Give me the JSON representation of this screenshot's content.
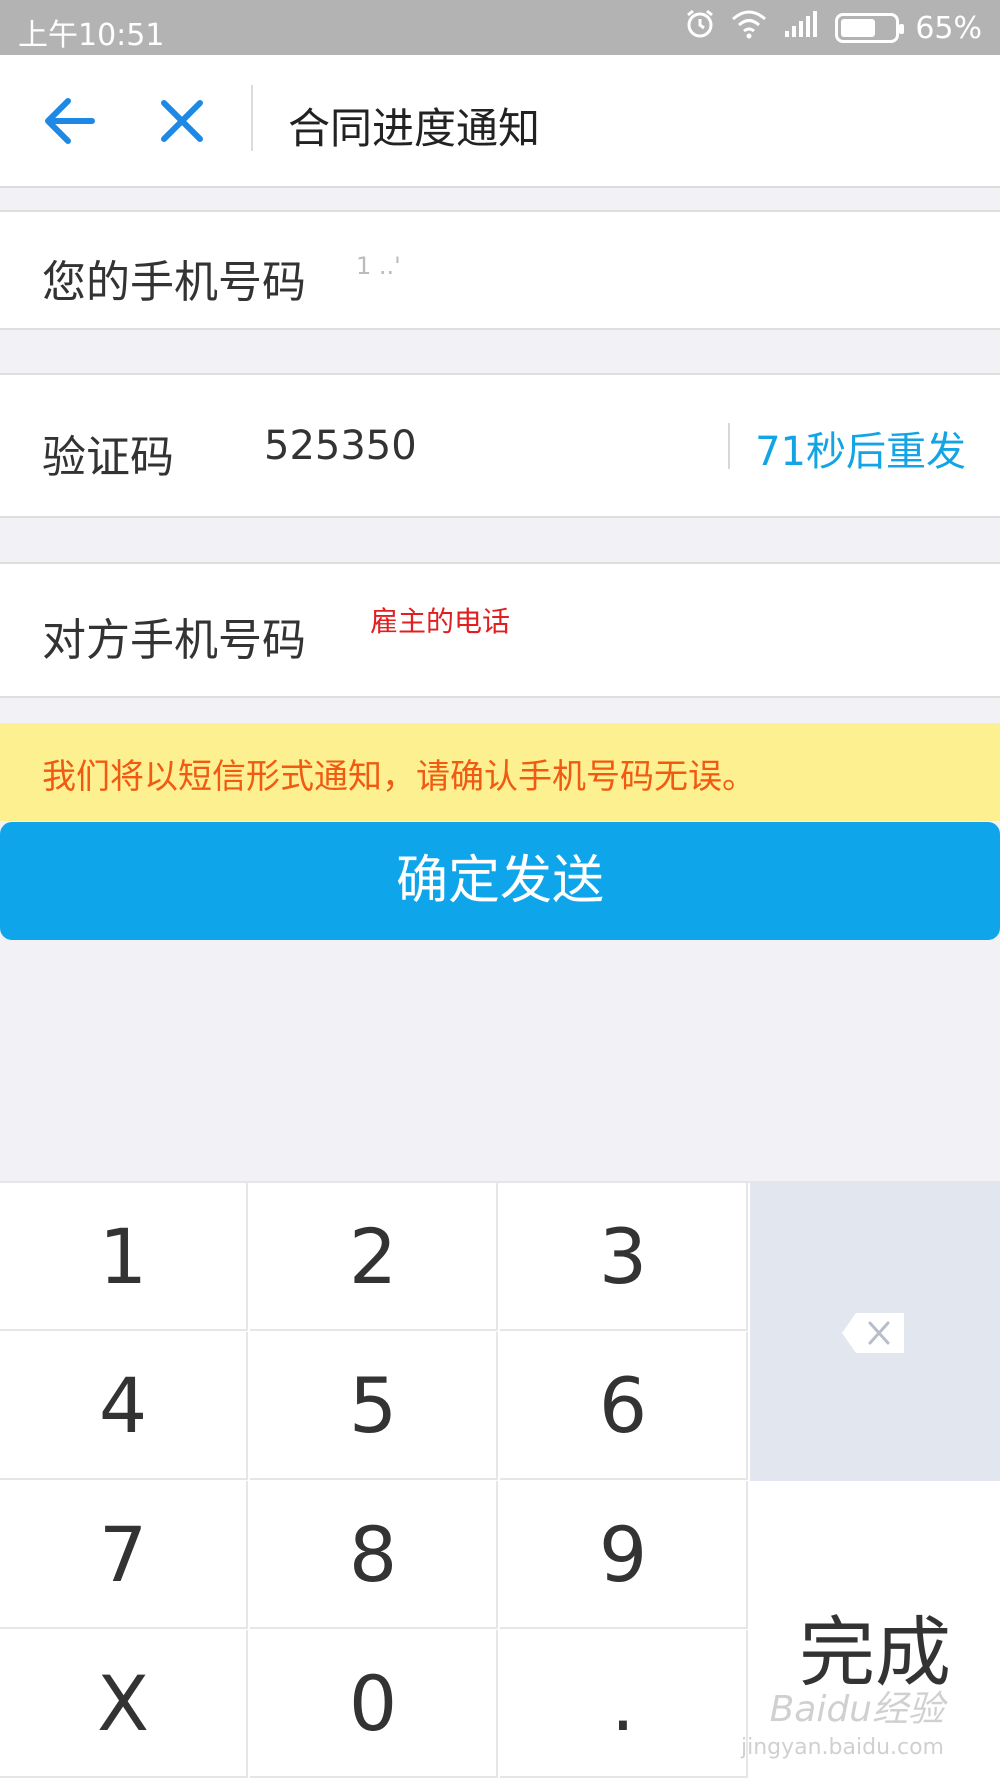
{
  "status_bar": {
    "time": "上午10:51",
    "battery_percent": "65%",
    "battery_level": 0.65,
    "icons": [
      "alarm-icon",
      "wifi-icon",
      "signal-icon",
      "battery-icon"
    ]
  },
  "nav": {
    "title": "合同进度通知",
    "back_icon": "arrow-left-icon",
    "close_icon": "close-icon",
    "accent_color": "#1e88e5"
  },
  "form": {
    "my_phone_label": "您的手机号码",
    "my_phone_value": "1          ..'",
    "code_label": "验证码",
    "code_value": "525350",
    "resend_label": "71秒后重发",
    "other_phone_label": "对方手机号码",
    "other_phone_hint": "雇主的电话"
  },
  "notice": {
    "text": "我们将以短信形式通知，请确认手机号码无误。",
    "bg_color": "#fdf090",
    "text_color": "#f05a12"
  },
  "send_button": {
    "label": "确定发送",
    "color": "#0fa5ea"
  },
  "keypad": {
    "keys": [
      "1",
      "2",
      "3",
      "4",
      "5",
      "6",
      "7",
      "8",
      "9",
      "X",
      "0",
      "."
    ],
    "delete_icon": "backspace-icon",
    "done_label": "完成"
  },
  "watermark": {
    "brand": "Baidu经验",
    "url": "jingyan.baidu.com"
  }
}
